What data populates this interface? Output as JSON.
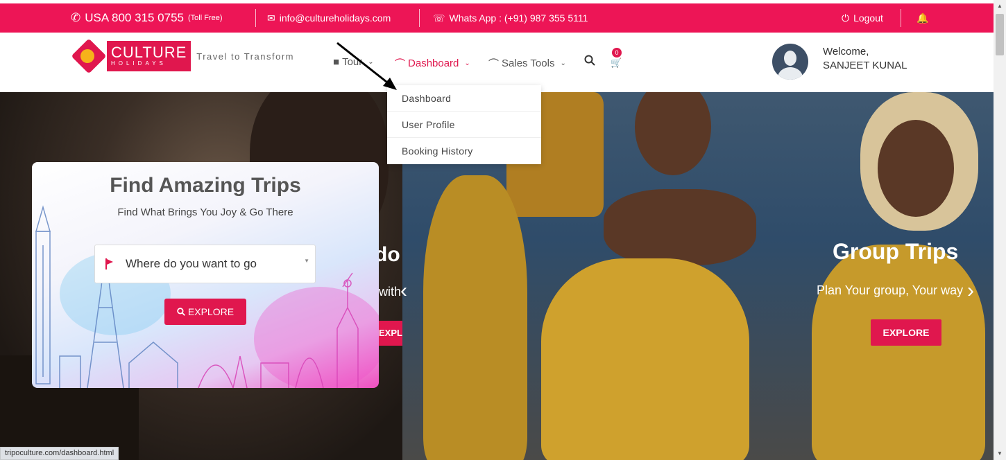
{
  "topbar": {
    "phone": "USA 800 315 0755",
    "phone_note": "(Toll Free)",
    "email": "info@cultureholidays.com",
    "whatsapp": "Whats App : (+91) 987 355 5111",
    "logout": "Logout",
    "bg_color": "#ed1556"
  },
  "header": {
    "logo_line1": "CULTURE",
    "logo_line2": "HOLIDAYS",
    "tagline": "Travel to Transform",
    "nav": {
      "tour": "Tour",
      "dashboard": "Dashboard",
      "sales_tools": "Sales Tools"
    },
    "cart_count": "0",
    "welcome": "Welcome,",
    "user_name": "SANJEET KUNAL"
  },
  "dropdown": {
    "items": [
      "Dashboard",
      "User Profile",
      "Booking History"
    ]
  },
  "search_card": {
    "title": "Find Amazing Trips",
    "subtitle": "Find What Brings You Joy & Go There",
    "destination_placeholder": "Where do you want to go",
    "explore": "EXPLORE"
  },
  "hero": {
    "left_title_fragment": "do",
    "left_sub_fragment": "with",
    "left_button_fragment": "EXPL",
    "right_title": "Group Trips",
    "right_subtitle": "Plan Your group, Your way",
    "right_button": "EXPLORE"
  },
  "status_url": "tripoculture.com/dashboard.html",
  "colors": {
    "accent": "#e0174e"
  }
}
